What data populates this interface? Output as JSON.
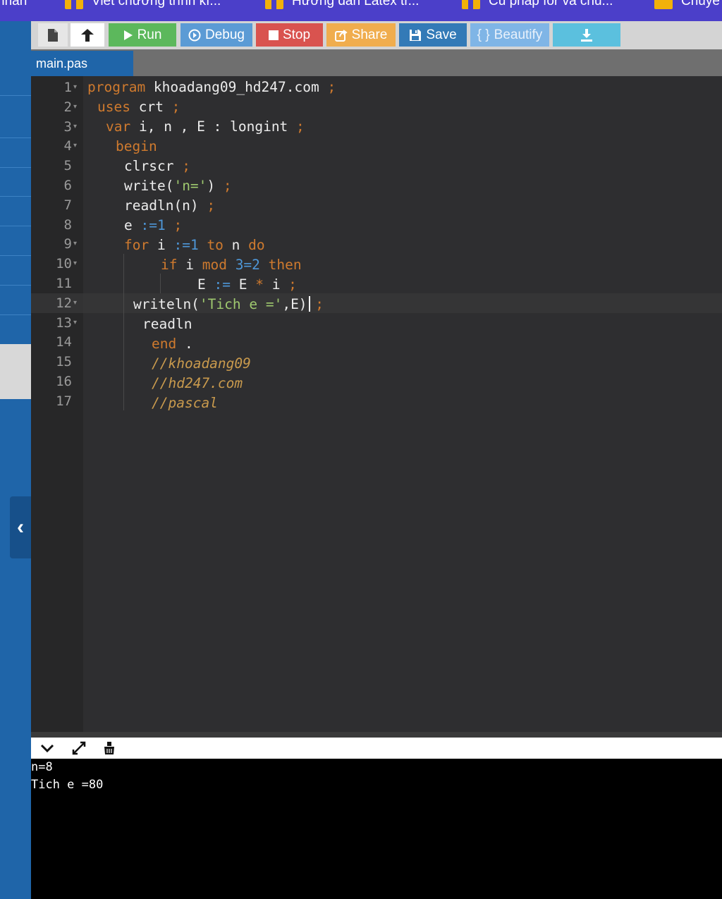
{
  "bookmarks": [
    {
      "label": "nhân",
      "icon": "none"
    },
    {
      "label": "Viết chương trình kí...",
      "icon": "hd247-icon"
    },
    {
      "label": "Hướng dẫn Latex tr...",
      "icon": "hd247-icon"
    },
    {
      "label": "Cú pháp for và chu...",
      "icon": "hd247-icon"
    },
    {
      "label": "Chuyê",
      "icon": "crown-icon"
    }
  ],
  "toolbar": {
    "run": "Run",
    "debug": "Debug",
    "stop": "Stop",
    "share": "Share",
    "save": "Save",
    "beautify": "Beautify",
    "beautify_glyph": "{ }"
  },
  "editor": {
    "tab": "main.pas",
    "line_numbers": [
      "1",
      "2",
      "3",
      "4",
      "5",
      "6",
      "7",
      "8",
      "9",
      "10",
      "11",
      "12",
      "13",
      "14",
      "15",
      "16",
      "17"
    ],
    "folded_lines": [
      1,
      2,
      3,
      4,
      9,
      10,
      12,
      13
    ],
    "active_line": 12,
    "code": {
      "l1_kw": "program",
      "l1_name": " khoadang09_hd247.com ",
      "l1_semi": ";",
      "l2_kw": "uses",
      "l2_name": " crt ",
      "l2_semi": ";",
      "l3_kw": "var",
      "l3_vars": " i, n , E : longint ",
      "l3_semi": ";",
      "l4_kw": "begin",
      "l5_text": "clrscr ",
      "l5_semi": ";",
      "l6_fn": "write(",
      "l6_str": "'n='",
      "l6_close": ") ",
      "l6_semi": ";",
      "l7_text": "readln(n) ",
      "l7_semi": ";",
      "l8_var": "e ",
      "l8_op": ":=1 ",
      "l8_semi": ";",
      "l9_kw": "for",
      "l9_var": " i ",
      "l9_op": ":=1 ",
      "l9_kw2": "to",
      "l9_var2": " n ",
      "l9_kw3": "do",
      "l10_kw": "if",
      "l10_var": " i ",
      "l10_kw2": "mod",
      "l10_num": " 3=2 ",
      "l10_kw3": "then",
      "l11_var": "E ",
      "l11_op": ":= ",
      "l11_var2": "E ",
      "l11_op2": "* ",
      "l11_var3": "i ",
      "l11_semi": ";",
      "l12_fn": "writeln(",
      "l12_str": "'Tich e ='",
      "l12_rest": ",E) ",
      "l12_semi": ";",
      "l13_text": "readln",
      "l14_kw": "end",
      "l14_dot": " .",
      "l15_cm": "//khoadang09",
      "l16_cm": "//hd247.com",
      "l17_cm": "//pascal"
    }
  },
  "console": {
    "lines": [
      "n=8",
      "Tich e =80"
    ]
  },
  "colors": {
    "keyword": "#cf7a2e",
    "number": "#4e97d8",
    "string": "#9fc96f",
    "comment": "#c99a4d",
    "editor_bg": "#2e2e30",
    "run": "#5cb85c",
    "stop": "#d9534f",
    "share": "#f0ad4e",
    "save": "#337ab7"
  }
}
